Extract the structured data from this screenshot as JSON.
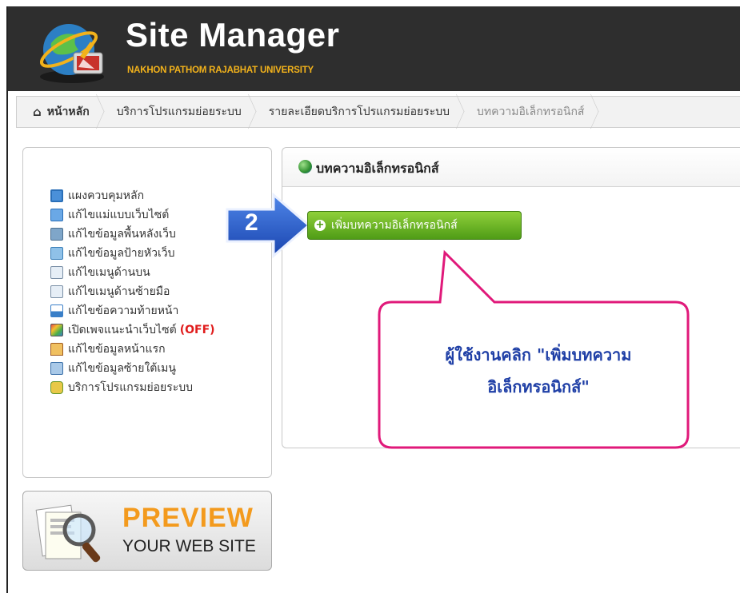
{
  "header": {
    "app_title": "Site Manager",
    "app_subtitle": "NAKHON PATHOM RAJABHAT UNIVERSITY"
  },
  "breadcrumb": [
    {
      "label": "หน้าหลัก",
      "icon": "home-icon"
    },
    {
      "label": "บริการโปรแกรมย่อยระบบ"
    },
    {
      "label": "รายละเอียดบริการโปรแกรมย่อยระบบ"
    },
    {
      "label": "บทความอิเล็กทรอนิกส์"
    }
  ],
  "sidebar": {
    "items": [
      {
        "label": "แผงควบคุมหลัก",
        "icon": "dashboard-icon"
      },
      {
        "label": "แก้ไขแม่แบบเว็บไซต์",
        "icon": "template-icon"
      },
      {
        "label": "แก้ไขข้อมูลพื้นหลังเว็บ",
        "icon": "background-icon"
      },
      {
        "label": "แก้ไขข้อมูลป้ายหัวเว็บ",
        "icon": "banner-icon"
      },
      {
        "label": "แก้ไขเมนูด้านบน",
        "icon": "top-menu-icon"
      },
      {
        "label": "แก้ไขเมนูด้านซ้ายมือ",
        "icon": "left-menu-icon"
      },
      {
        "label": "แก้ไขข้อความท้ายหน้า",
        "icon": "footer-icon"
      },
      {
        "label": "เปิดเพจแนะนำเว็บไซต์",
        "status": "(OFF)",
        "icon": "intro-page-icon"
      },
      {
        "label": "แก้ไขข้อมูลหน้าแรก",
        "icon": "home-page-icon"
      },
      {
        "label": "แก้ไขข้อมูลซ้ายใต้เมนู",
        "icon": "sub-menu-icon"
      },
      {
        "label": "บริการโปรแกรมย่อยระบบ",
        "icon": "services-icon"
      }
    ]
  },
  "preview": {
    "title": "PREVIEW",
    "subtitle": "YOUR WEB SITE"
  },
  "panel": {
    "title": "บทความอิเล็กทรอนิกส์",
    "add_button": "เพิ่มบทความอิเล็กทรอนิกส์"
  },
  "annotation": {
    "step": "2",
    "line1": "ผู้ใช้งานคลิก \"เพิ่มบทความ",
    "line2": "อิเล็กทรอนิกส์\""
  },
  "colors": {
    "header_bg": "#2e2e2e",
    "brand_gold": "#f2b21b",
    "button_green": "#6fb52a",
    "callout_pink": "#e0197a",
    "callout_text": "#1f3fa6",
    "arrow_blue": "#1f56c8",
    "off_red": "#e01c1c",
    "preview_orange": "#f39a1d"
  }
}
